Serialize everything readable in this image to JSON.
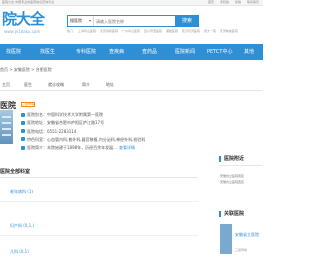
{
  "topbar": {
    "left_text": "医院大全-中国专业的医院信息查询平台",
    "right_links": [
      "首页",
      "手机版",
      "投稿",
      "联系我们"
    ]
  },
  "logo": {
    "text": "院大全",
    "url": "www.yi1daku.com"
  },
  "search": {
    "type_label": "搜医院",
    "placeholder": "请输入医院名称",
    "button_label": "搜索"
  },
  "hotwords": [
    "热门:",
    "上海华山医院",
    "北京协和医院",
    "广州中山医院",
    "四川华西医院",
    "湘雅医院",
    "武汉同济医院",
    "浙大一院",
    "天津肿瘤医院"
  ],
  "nav": {
    "items": [
      "找医院",
      "找医生",
      "专科医院",
      "查疾病",
      "查药品",
      "医院新闻",
      "PETCT中心",
      "其他"
    ]
  },
  "breadcrumb": "首页 > 安徽医院 > 合肥医院",
  "subtabs": [
    "主页",
    "医生",
    "就诊攻略",
    "简介",
    "地址"
  ],
  "hospital": {
    "name": "医院",
    "badge": "三级甲等",
    "rows": [
      {
        "label": "医院别名：",
        "value": "中国科学技术大学附属第一医院"
      },
      {
        "label": "医院地址：",
        "value": "安徽省合肥市庐阳区庐江路17号"
      },
      {
        "label": "医院电话：",
        "value": "0551-2283114"
      },
      {
        "label": "特色科室：",
        "value": "心血管内科,普外科,器官移植,内分泌科,神经外科,检验科"
      },
      {
        "label": "医院简介：",
        "value": "本院始建于1898年，历经百余年发展...",
        "more": "查看详情"
      }
    ]
  },
  "departments": {
    "title": "医院全部科室",
    "items": [
      "老年病科 (1)",
      "妇产科 (0,1,)",
      "儿科 (0,1)"
    ]
  },
  "sidebar": {
    "nearby_title": "医院附近",
    "nearby_text": [
      "·安徽省立医院南区",
      "·安徽省立医院西区"
    ],
    "related_title": "关联医院",
    "related_name": "安徽省立医院",
    "related_level": "三级甲等"
  }
}
